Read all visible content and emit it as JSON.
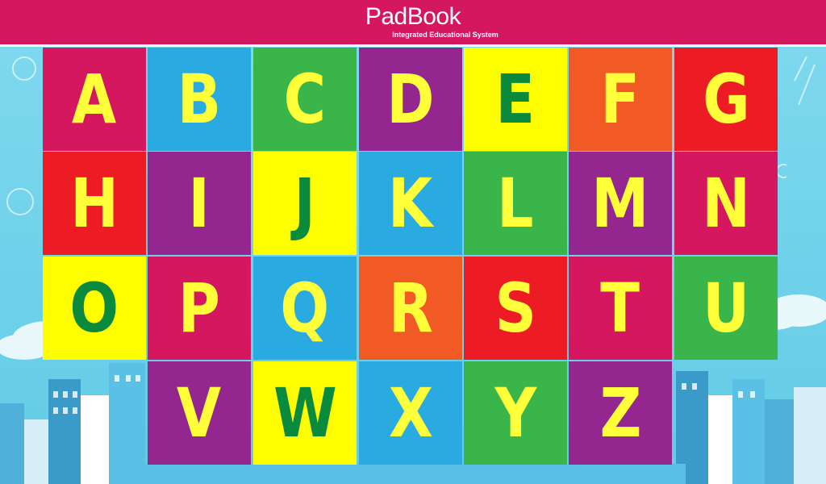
{
  "header": {
    "brand_name": "PadBook",
    "tagline": "Integrated Educational System"
  },
  "colors": {
    "header": "#d5175f",
    "sky": "#6fd3ea",
    "letter_default": "#ffff3a",
    "letter_green": "#0a8a3c"
  },
  "tiles": [
    {
      "letter": "A",
      "bg": "#d5175f",
      "fg": "#ffff3a"
    },
    {
      "letter": "B",
      "bg": "#29abe2",
      "fg": "#ffff3a"
    },
    {
      "letter": "C",
      "bg": "#39b54a",
      "fg": "#ffff3a"
    },
    {
      "letter": "D",
      "bg": "#93278f",
      "fg": "#ffff3a"
    },
    {
      "letter": "E",
      "bg": "#ffff00",
      "fg": "#0a8a3c"
    },
    {
      "letter": "F",
      "bg": "#f15a24",
      "fg": "#ffff3a"
    },
    {
      "letter": "G",
      "bg": "#ed1c24",
      "fg": "#ffff3a"
    },
    {
      "letter": "H",
      "bg": "#ed1c24",
      "fg": "#ffff3a"
    },
    {
      "letter": "I",
      "bg": "#93278f",
      "fg": "#ffff3a"
    },
    {
      "letter": "J",
      "bg": "#ffff00",
      "fg": "#0a8a3c"
    },
    {
      "letter": "K",
      "bg": "#29abe2",
      "fg": "#ffff3a"
    },
    {
      "letter": "L",
      "bg": "#39b54a",
      "fg": "#ffff3a"
    },
    {
      "letter": "M",
      "bg": "#93278f",
      "fg": "#ffff3a"
    },
    {
      "letter": "N",
      "bg": "#d5175f",
      "fg": "#ffff3a"
    },
    {
      "letter": "O",
      "bg": "#ffff00",
      "fg": "#0a8a3c"
    },
    {
      "letter": "P",
      "bg": "#d5175f",
      "fg": "#ffff3a"
    },
    {
      "letter": "Q",
      "bg": "#29abe2",
      "fg": "#ffff3a"
    },
    {
      "letter": "R",
      "bg": "#f15a24",
      "fg": "#ffff3a"
    },
    {
      "letter": "S",
      "bg": "#ed1c24",
      "fg": "#ffff3a"
    },
    {
      "letter": "T",
      "bg": "#d5175f",
      "fg": "#ffff3a"
    },
    {
      "letter": "U",
      "bg": "#39b54a",
      "fg": "#ffff3a"
    },
    {
      "letter": "V",
      "bg": "#93278f",
      "fg": "#ffff3a"
    },
    {
      "letter": "W",
      "bg": "#ffff00",
      "fg": "#0a8a3c"
    },
    {
      "letter": "X",
      "bg": "#29abe2",
      "fg": "#ffff3a"
    },
    {
      "letter": "Y",
      "bg": "#39b54a",
      "fg": "#ffff3a"
    },
    {
      "letter": "Z",
      "bg": "#93278f",
      "fg": "#ffff3a"
    }
  ]
}
